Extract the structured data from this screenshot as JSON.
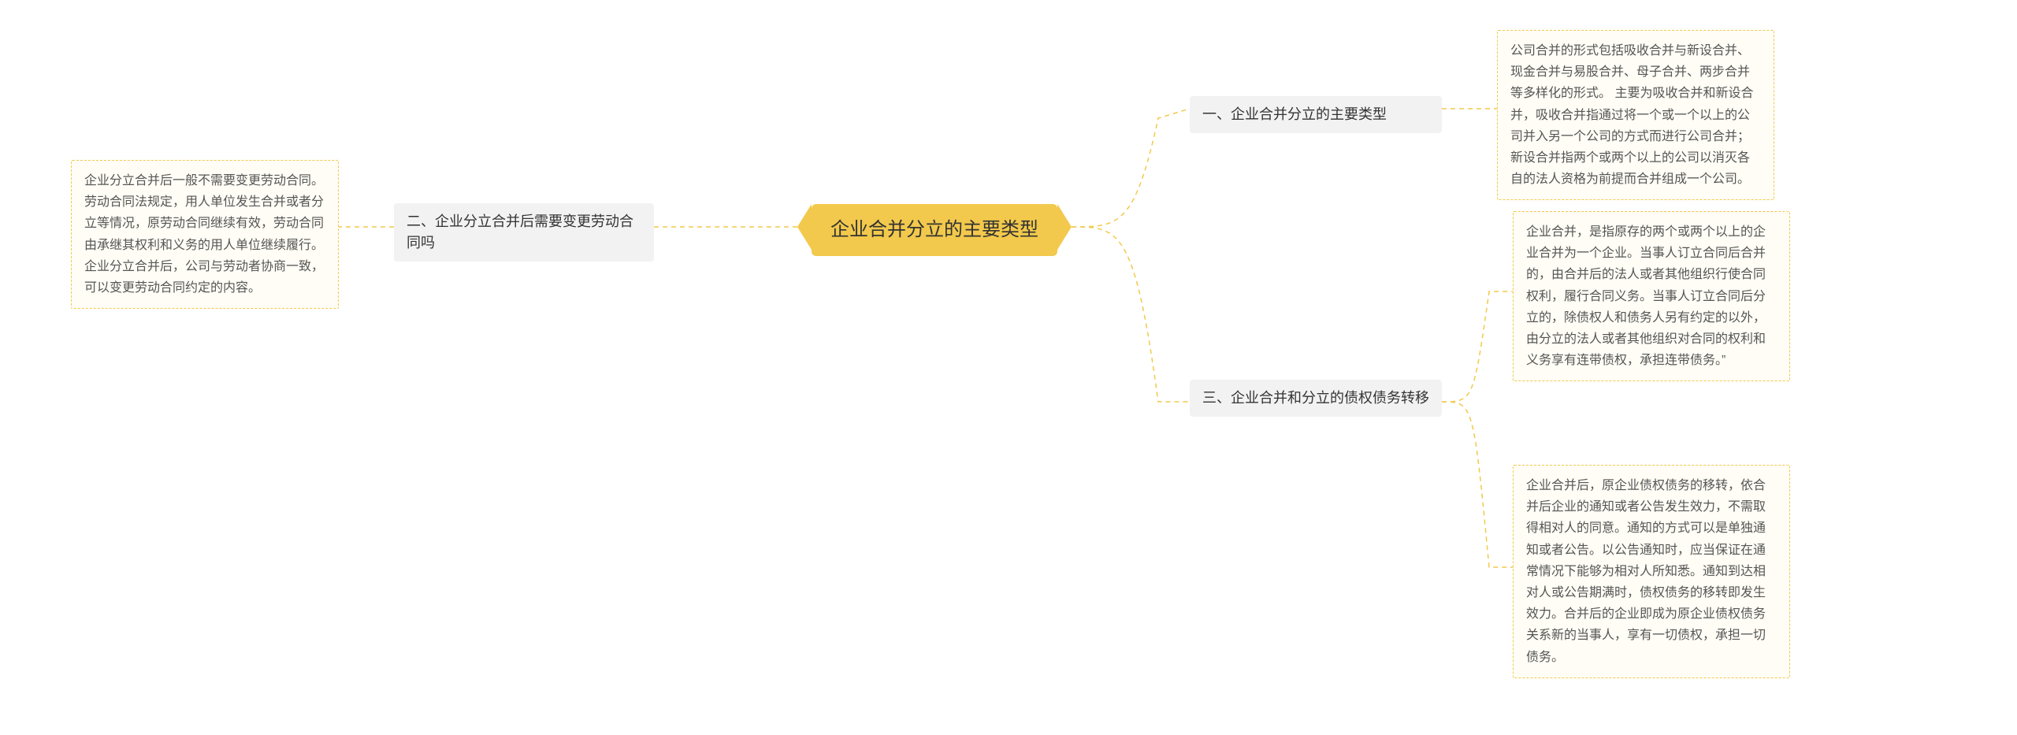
{
  "root": {
    "title": "企业合并分立的主要类型"
  },
  "left": {
    "branch2": {
      "title": "二、企业分立合并后需要变更劳动合同吗",
      "leaf": "企业分立合并后一般不需要变更劳动合同。劳动合同法规定，用人单位发生合并或者分立等情况，原劳动合同继续有效，劳动合同由承继其权利和义务的用人单位继续履行。企业分立合并后，公司与劳动者协商一致，可以变更劳动合同约定的内容。"
    }
  },
  "right": {
    "branch1": {
      "title": "一、企业合并分立的主要类型",
      "leaf": "公司合并的形式包括吸收合并与新设合并、现金合并与易股合并、母子合并、两步合并等多样化的形式。 主要为吸收合并和新设合并，吸收合并指通过将一个或一个以上的公司并入另一个公司的方式而进行公司合并；新设合并指两个或两个以上的公司以消灭各自的法人资格为前提而合并组成一个公司。"
    },
    "branch3": {
      "title": "三、企业合并和分立的债权债务转移",
      "leaf1": "企业合并，是指原存的两个或两个以上的企业合并为一个企业。当事人订立合同后合并的，由合并后的法人或者其他组织行使合同权利，履行合同义务。当事人订立合同后分立的，除债权人和债务人另有约定的以外，由分立的法人或者其他组织对合同的权利和义务享有连带债权，承担连带债务。”",
      "leaf2": "企业合并后，原企业债权债务的移转，依合并后企业的通知或者公告发生效力，不需取得相对人的同意。通知的方式可以是单独通知或者公告。以公告通知时，应当保证在通常情况下能够为相对人所知悉。通知到达相对人或公告期满时，债权债务的移转即发生效力。合并后的企业即成为原企业债权债务关系新的当事人，享有一切债权，承担一切债务。"
    }
  }
}
